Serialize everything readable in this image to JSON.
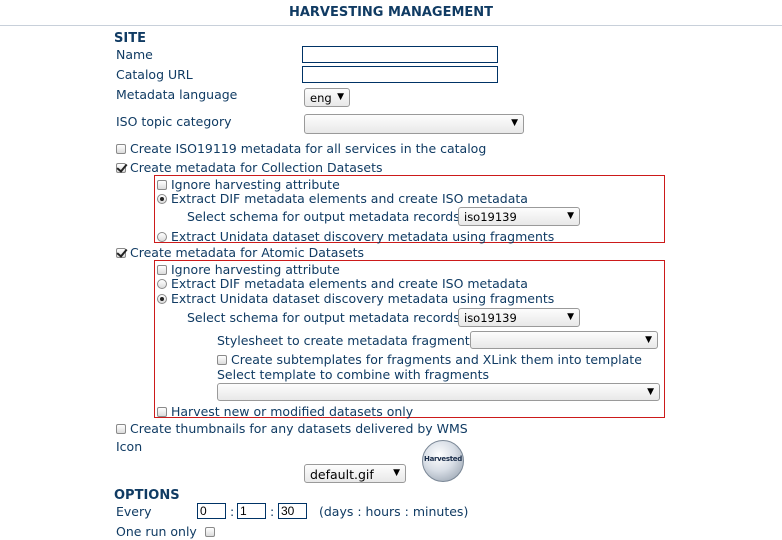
{
  "header": {
    "title": "HARVESTING MANAGEMENT"
  },
  "site": {
    "section_label": "SITE",
    "name_label": "Name",
    "name_value": "",
    "catalog_url_label": "Catalog URL",
    "catalog_url_value": "",
    "metadata_language_label": "Metadata language",
    "metadata_language_value": "eng",
    "iso_topic_label": "ISO topic category",
    "iso_topic_value": "",
    "create_iso19119_label": "Create ISO19119 metadata for all services in the catalog",
    "create_iso19119_checked": false,
    "collection": {
      "label": "Create metadata for Collection Datasets",
      "checked": true,
      "ignore_label": "Ignore harvesting attribute",
      "ignore_checked": false,
      "extract_dif_label": "Extract DIF metadata elements and create ISO metadata",
      "extract_dif_selected": true,
      "schema_label": "Select schema for output metadata records",
      "schema_value": "iso19139",
      "extract_unidata_label": "Extract Unidata dataset discovery metadata using fragments",
      "extract_unidata_selected": false
    },
    "atomic": {
      "label": "Create metadata for Atomic Datasets",
      "checked": true,
      "ignore_label": "Ignore harvesting attribute",
      "ignore_checked": false,
      "extract_dif_label": "Extract DIF metadata elements and create ISO metadata",
      "extract_dif_selected": false,
      "extract_unidata_label": "Extract Unidata dataset discovery metadata using fragments",
      "extract_unidata_selected": true,
      "schema_label": "Select schema for output metadata records",
      "schema_value": "iso19139",
      "stylesheet_label": "Stylesheet to create metadata fragments",
      "stylesheet_value": "",
      "subtemplates_label": "Create subtemplates for fragments and XLink them into template",
      "subtemplates_checked": false,
      "template_label": "Select template to combine with fragments",
      "template_value": "",
      "harvest_new_label": "Harvest new or modified datasets only",
      "harvest_new_checked": false
    },
    "thumbnails_label": "Create thumbnails for any datasets delivered by WMS",
    "thumbnails_checked": false,
    "icon_label": "Icon",
    "icon_value": "default.gif",
    "icon_logo_text": "Harvested"
  },
  "options": {
    "section_label": "OPTIONS",
    "every_label": "Every",
    "days": "0",
    "hours": "1",
    "minutes": "30",
    "separator": ":",
    "units_label": "(days : hours : minutes)",
    "one_run_label": "One run only",
    "one_run_checked": false
  }
}
